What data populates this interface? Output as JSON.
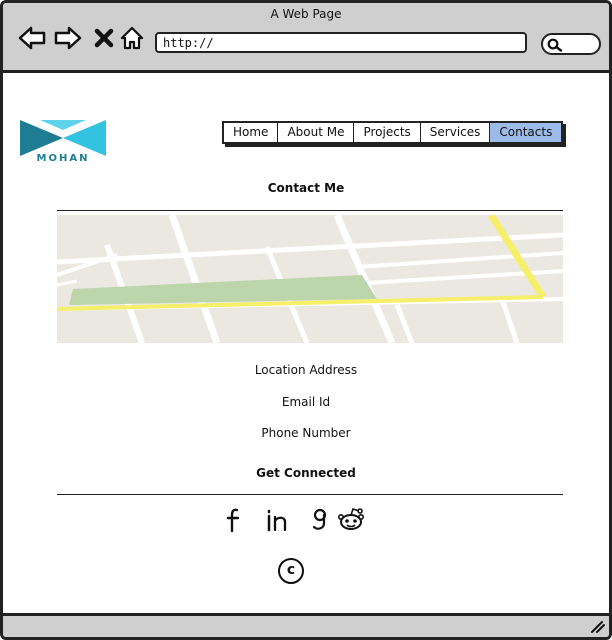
{
  "window": {
    "title": "A Web Page",
    "address": "http://"
  },
  "logo": {
    "text": "MOHAN"
  },
  "nav": {
    "items": [
      {
        "label": "Home"
      },
      {
        "label": "About Me"
      },
      {
        "label": "Projects"
      },
      {
        "label": "Services"
      },
      {
        "label": "Contacts",
        "active": true
      }
    ]
  },
  "contact": {
    "heading": "Contact Me",
    "location": "Location Address",
    "email": "Email Id",
    "phone": "Phone Number"
  },
  "connect": {
    "heading": "Get Connected",
    "icons": [
      "facebook-icon",
      "linkedin-icon",
      "google-plus-icon",
      "reddit-icon"
    ]
  },
  "footer": {
    "copyright_symbol": "c"
  },
  "colors": {
    "chrome": "#cfcfcf",
    "active_tab": "#9dbbe9",
    "logo_dark": "#1f7d93",
    "logo_light": "#33c3e0",
    "map_road_yellow": "#f5ef6a",
    "map_park": "#bcd5aa",
    "map_ground": "#ebe8e1"
  }
}
